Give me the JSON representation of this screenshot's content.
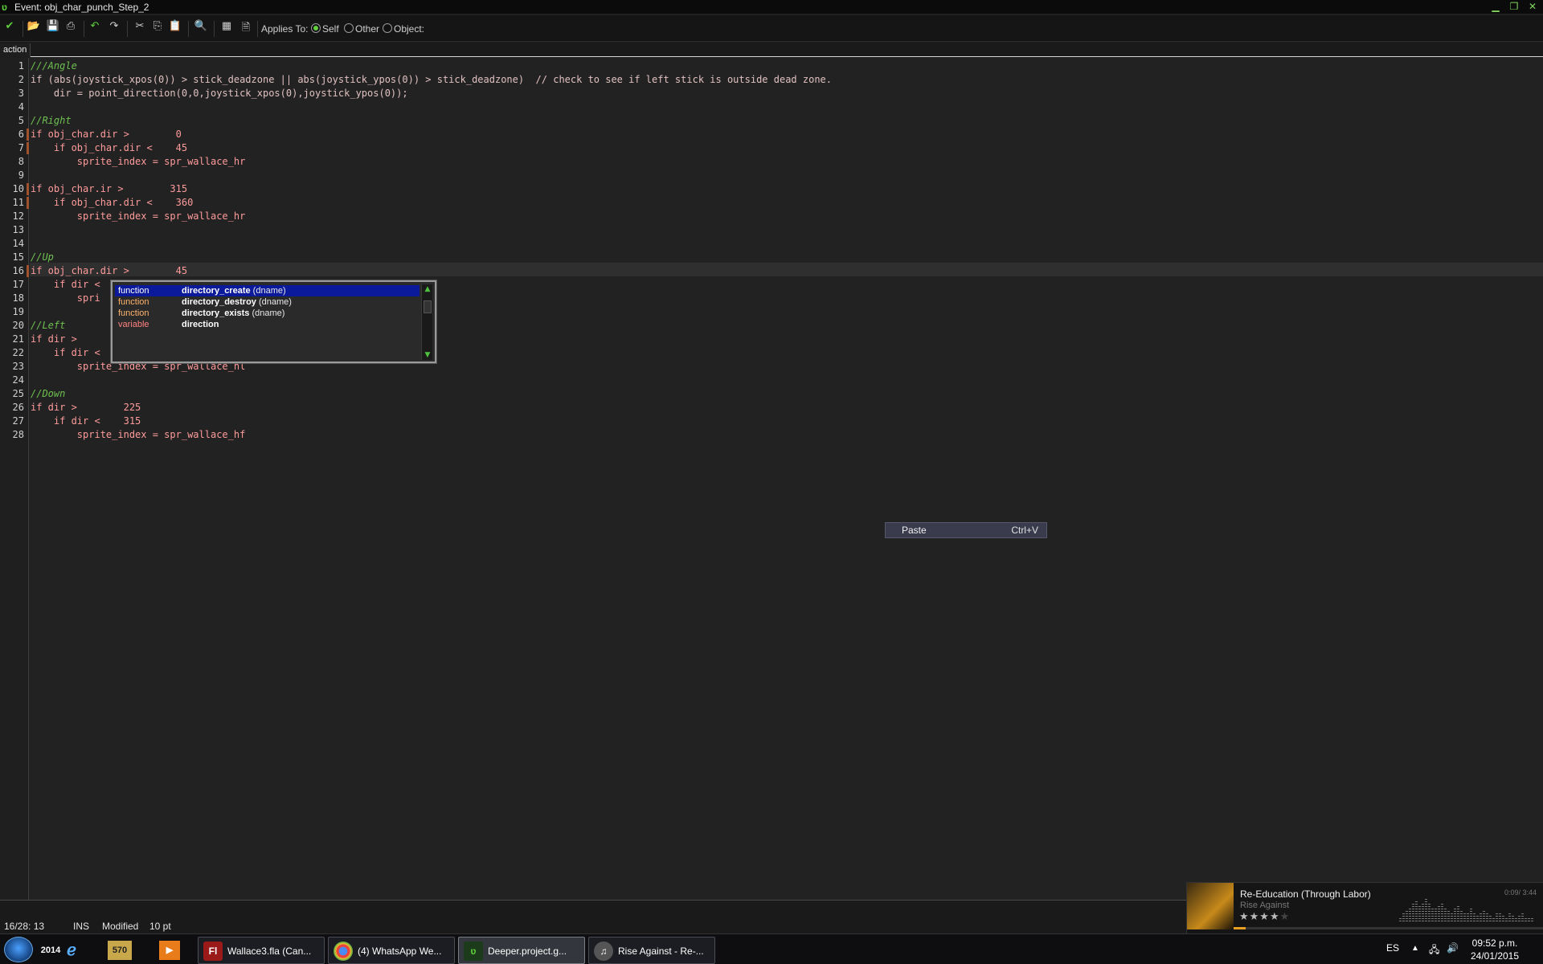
{
  "window": {
    "title": "Event: obj_char_punch_Step_2"
  },
  "toolbar": {
    "applies_to_label": "Applies To:",
    "options": [
      {
        "label": "Self",
        "selected": true
      },
      {
        "label": "Other",
        "selected": false
      },
      {
        "label": "Object:",
        "selected": false
      }
    ]
  },
  "tabs": [
    {
      "label": "action"
    }
  ],
  "editor": {
    "line_numbers": [
      "1",
      "2",
      "3",
      "4",
      "5",
      "6",
      "7",
      "8",
      "9",
      "10",
      "11",
      "12",
      "13",
      "14",
      "15",
      "16",
      "17",
      "18",
      "19",
      "20",
      "21",
      "22",
      "23",
      "24",
      "25",
      "26",
      "27",
      "28"
    ],
    "current_line": 16,
    "lines": [
      "///Angle",
      "if (abs(joystick_xpos(0)) > stick_deadzone || abs(joystick_ypos(0)) > stick_deadzone)  // check to see if left stick is outside dead zone.",
      "    dir = point_direction(0,0,joystick_xpos(0),joystick_ypos(0));",
      "",
      "//Right",
      "if obj_char.dir >        0",
      "    if obj_char.dir <    45",
      "        sprite_index = spr_wallace_hr",
      "",
      "if obj_char.ir >        315",
      "    if obj_char.dir <    360",
      "        sprite_index = spr_wallace_hr",
      "",
      "",
      "//Up",
      "if obj_char.dir >        45",
      "    if dir <",
      "        spri",
      "",
      "//Left",
      "if dir >",
      "    if dir <",
      "        sprite_index = spr_wallace_hl",
      "",
      "//Down",
      "if dir >        225",
      "    if dir <    315",
      "        sprite_index = spr_wallace_hf"
    ]
  },
  "autocomplete": {
    "items": [
      {
        "kind": "function",
        "name": "directory_create",
        "args": "(dname)",
        "selected": true
      },
      {
        "kind": "function",
        "name": "directory_destroy",
        "args": "(dname)",
        "selected": false
      },
      {
        "kind": "function",
        "name": "directory_exists",
        "args": "(dname)",
        "selected": false
      },
      {
        "kind": "variable",
        "name": "direction",
        "args": "",
        "selected": false
      }
    ]
  },
  "context_menu": {
    "paste_label": "Paste",
    "paste_shortcut": "Ctrl+V"
  },
  "statusbar": {
    "position": "16/28: 13",
    "mode": "INS",
    "state": "Modified",
    "font_size": "10 pt"
  },
  "taskbar": {
    "quick_launch": [
      "2014",
      "570"
    ],
    "tasks": [
      {
        "label": "Wallace3.fla (Can...",
        "icon": "flash-icon",
        "active": false
      },
      {
        "label": "(4) WhatsApp We...",
        "icon": "chrome-icon",
        "active": false
      },
      {
        "label": "Deeper.project.g...",
        "icon": "gamemaker-icon",
        "active": true
      },
      {
        "label": "Rise Against - Re-...",
        "icon": "media-player-icon",
        "active": false
      }
    ],
    "language": "ES",
    "time": "09:52 p.m.",
    "date": "24/01/2015"
  },
  "media": {
    "title": "Re-Education (Through Labor)",
    "artist": "Rise Against",
    "rating": "★★★★★",
    "rating_value": 4,
    "time": "0:09/ 3:44",
    "progress": 0.04
  },
  "colors": {
    "accent_green": "#5fcf3c",
    "selection_blue": "#0a1a9a",
    "comment_green": "#6ec050"
  }
}
